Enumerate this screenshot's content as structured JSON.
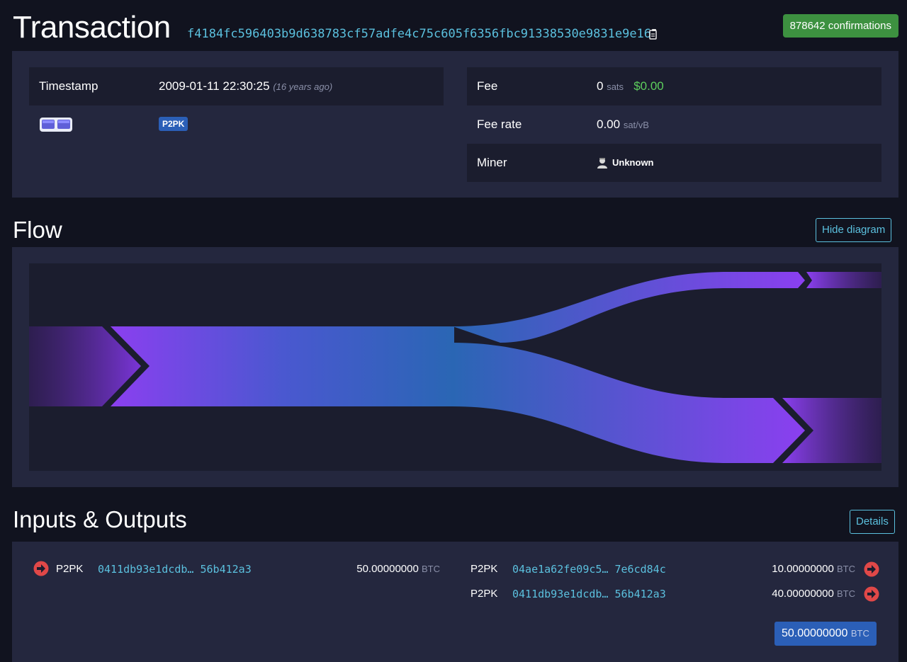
{
  "header": {
    "title": "Transaction",
    "txid": "f4184fc596403b9d638783cf57adfe4c75c605f6356fbc91338530e9831e9e16",
    "confirmations": "878642 confirmations"
  },
  "summary": {
    "timestamp_label": "Timestamp",
    "timestamp_value": "2009-01-11 22:30:25",
    "timestamp_ago": "(16 years ago)",
    "script_badge": "P2PK",
    "fee_label": "Fee",
    "fee_value": "0",
    "fee_unit": "sats",
    "fee_usd": "$0.00",
    "feerate_label": "Fee rate",
    "feerate_value": "0.00",
    "feerate_unit": "sat/vB",
    "miner_label": "Miner",
    "miner_value": "Unknown"
  },
  "flow": {
    "title": "Flow",
    "toggle_label": "Hide diagram",
    "input_total": 50,
    "outputs": [
      10,
      40
    ]
  },
  "io": {
    "title": "Inputs & Outputs",
    "details_label": "Details",
    "inputs": [
      {
        "type": "P2PK",
        "address": "0411db93e1dcdb… 56b412a3",
        "amount": "50.00000000",
        "unit": "BTC"
      }
    ],
    "outputs": [
      {
        "type": "P2PK",
        "address": "04ae1a62fe09c5… 7e6cd84c",
        "amount": "10.00000000",
        "unit": "BTC"
      },
      {
        "type": "P2PK",
        "address": "0411db93e1dcdb… 56b412a3",
        "amount": "40.00000000",
        "unit": "BTC"
      }
    ],
    "total_amount": "50.00000000",
    "total_unit": "BTC"
  },
  "colors": {
    "background": "#11131f",
    "panel": "#24273e",
    "link": "#5bc0de",
    "confirm": "#3d9140",
    "badge_blue": "#2b5fb7",
    "flow_purple": "#8b3ff0",
    "flow_blue": "#2a66b4",
    "arrow_red": "#e04848"
  }
}
